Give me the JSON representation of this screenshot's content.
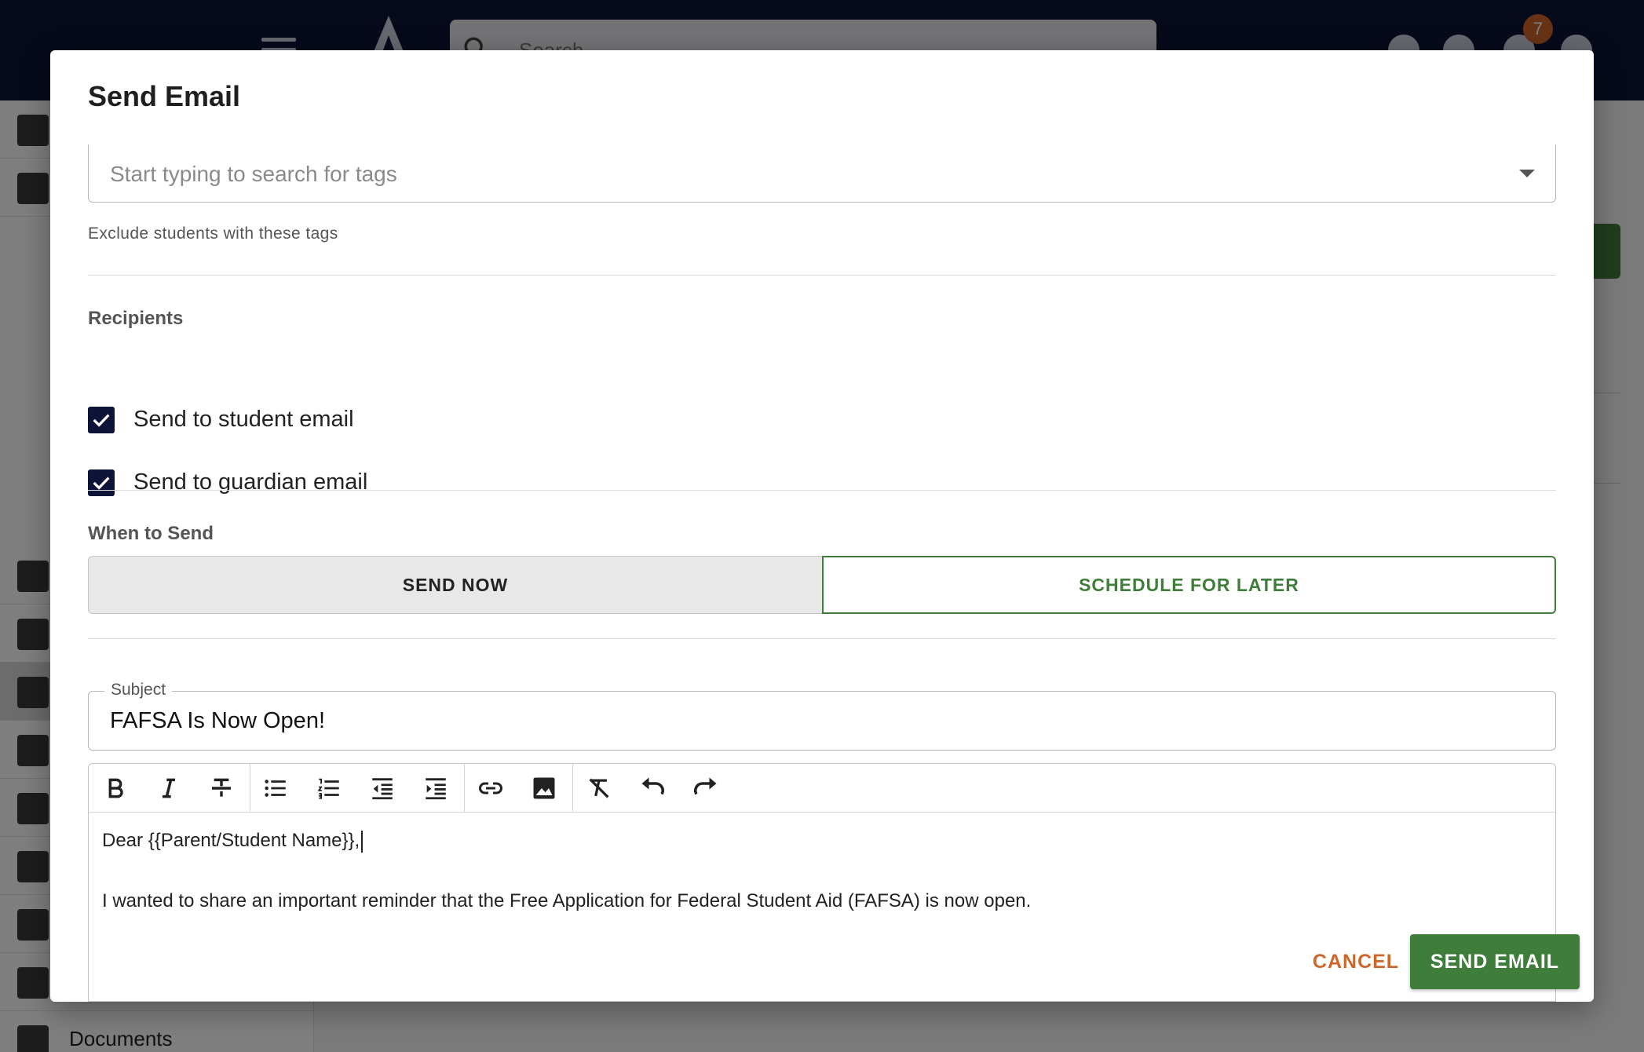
{
  "topbar": {
    "search_placeholder": "Search",
    "notification_count": "7"
  },
  "sidebar": {
    "visible_label": "Documents"
  },
  "dialog": {
    "title": "Send Email",
    "exclude_tags": {
      "placeholder": "Start typing to search for tags",
      "helper": "Exclude students with these tags"
    },
    "recipients": {
      "label": "Recipients",
      "options": [
        {
          "label": "Send to student email",
          "checked": true
        },
        {
          "label": "Send to guardian email",
          "checked": true
        }
      ]
    },
    "when_to_send": {
      "label": "When to Send",
      "send_now": "SEND NOW",
      "schedule_later": "SCHEDULE FOR LATER",
      "selected": "SCHEDULE FOR LATER"
    },
    "subject": {
      "label": "Subject",
      "value": "FAFSA Is Now Open!"
    },
    "editor": {
      "toolbar": [
        "bold-icon",
        "italic-icon",
        "strikethrough-icon",
        "bulleted-list-icon",
        "numbered-list-icon",
        "outdent-icon",
        "indent-icon",
        "link-icon",
        "image-icon",
        "clear-format-icon",
        "undo-icon",
        "redo-icon"
      ],
      "line1": "Dear {{Parent/Student Name}},",
      "line2": "I wanted to share an important reminder that the Free Application for Federal Student Aid (FAFSA) is now open."
    },
    "actions": {
      "cancel": "CANCEL",
      "send": "SEND EMAIL"
    }
  },
  "colors": {
    "navy": "#0d1437",
    "green": "#3f7d3a",
    "orange": "#d0672a"
  }
}
